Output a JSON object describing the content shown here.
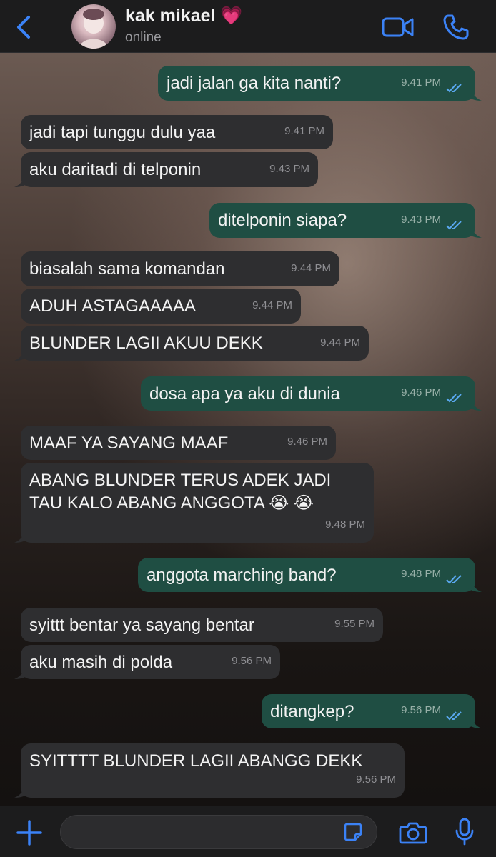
{
  "header": {
    "contact_name": "kak mikael 💗",
    "status": "online",
    "icons": [
      "chevron-left-icon",
      "avatar",
      "video-call-icon",
      "phone-icon"
    ],
    "accent_color": "#3b82f6"
  },
  "messages": [
    {
      "dir": "out",
      "text": "jadi jalan ga kita nanti?",
      "time": "9.41 PM",
      "read": true
    },
    {
      "dir": "in",
      "text": "jadi tapi tunggu dulu yaa",
      "time": "9.41 PM"
    },
    {
      "dir": "in",
      "text": "aku daritadi di telponin",
      "time": "9.43 PM"
    },
    {
      "dir": "out",
      "text": "ditelponin siapa?",
      "time": "9.43 PM",
      "read": true
    },
    {
      "dir": "in",
      "text": "biasalah sama komandan",
      "time": "9.44 PM"
    },
    {
      "dir": "in",
      "text": "ADUH ASTAGAAAAA",
      "time": "9.44 PM"
    },
    {
      "dir": "in",
      "text": "BLUNDER LAGII AKUU DEKK",
      "time": "9.44 PM"
    },
    {
      "dir": "out",
      "text": "dosa apa ya aku di dunia",
      "time": "9.46 PM",
      "read": true
    },
    {
      "dir": "in",
      "text": "MAAF YA SAYANG MAAF",
      "time": "9.46 PM"
    },
    {
      "dir": "in",
      "text": "ABANG BLUNDER TERUS ADEK JADI TAU KALO ABANG ANGGOTA 😭 😭",
      "time": "9.48 PM"
    },
    {
      "dir": "out",
      "text": "anggota marching band?",
      "time": "9.48 PM",
      "read": true
    },
    {
      "dir": "in",
      "text": "syittt bentar ya sayang bentar",
      "time": "9.55 PM"
    },
    {
      "dir": "in",
      "text": "aku masih di polda",
      "time": "9.56 PM"
    },
    {
      "dir": "out",
      "text": "ditangkep?",
      "time": "9.56 PM",
      "read": true
    },
    {
      "dir": "in",
      "text": "SYITTTT BLUNDER LAGII ABANGG DEKK",
      "time": "9.56 PM"
    }
  ],
  "footer": {
    "input_value": "",
    "icons": [
      "plus-icon",
      "sticker-icon",
      "camera-icon",
      "microphone-icon"
    ]
  }
}
